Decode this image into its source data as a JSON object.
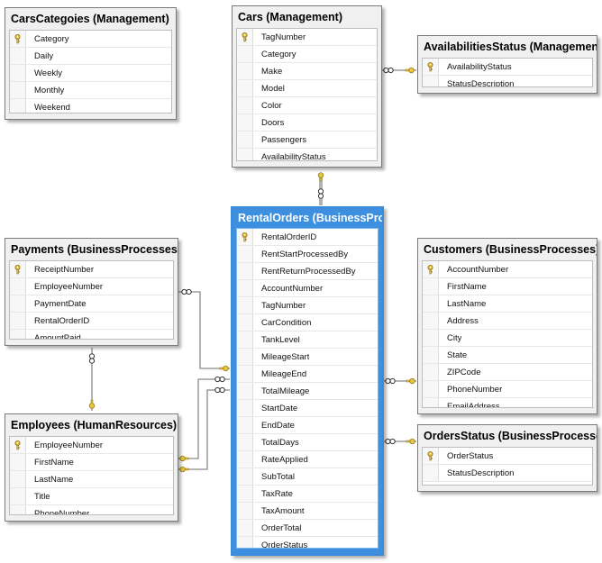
{
  "tables": [
    {
      "id": "carscategoies",
      "title": "CarsCategoies (Management)",
      "selected": false,
      "columns": [
        {
          "name": "Category",
          "pk": true
        },
        {
          "name": "Daily",
          "pk": false
        },
        {
          "name": "Weekly",
          "pk": false
        },
        {
          "name": "Monthly",
          "pk": false
        },
        {
          "name": "Weekend",
          "pk": false
        }
      ]
    },
    {
      "id": "cars",
      "title": "Cars (Management)",
      "selected": false,
      "columns": [
        {
          "name": "TagNumber",
          "pk": true
        },
        {
          "name": "Category",
          "pk": false
        },
        {
          "name": "Make",
          "pk": false
        },
        {
          "name": "Model",
          "pk": false
        },
        {
          "name": "Color",
          "pk": false
        },
        {
          "name": "Doors",
          "pk": false
        },
        {
          "name": "Passengers",
          "pk": false
        },
        {
          "name": "AvailabilityStatus",
          "pk": false
        }
      ]
    },
    {
      "id": "availabilitiesstatus",
      "title": "AvailabilitiesStatus (Management)",
      "selected": false,
      "columns": [
        {
          "name": "AvailabilityStatus",
          "pk": true
        },
        {
          "name": "StatusDescription",
          "pk": false
        }
      ]
    },
    {
      "id": "payments",
      "title": "Payments (BusinessProcesses)",
      "selected": false,
      "columns": [
        {
          "name": "ReceiptNumber",
          "pk": true
        },
        {
          "name": "EmployeeNumber",
          "pk": false
        },
        {
          "name": "PaymentDate",
          "pk": false
        },
        {
          "name": "RentalOrderID",
          "pk": false
        },
        {
          "name": "AmountPaid",
          "pk": false
        }
      ]
    },
    {
      "id": "rentalorders",
      "title": "RentalOrders (BusinessProc",
      "selected": true,
      "columns": [
        {
          "name": "RentalOrderID",
          "pk": true
        },
        {
          "name": "RentStartProcessedBy",
          "pk": false
        },
        {
          "name": "RentReturnProcessedBy",
          "pk": false
        },
        {
          "name": "AccountNumber",
          "pk": false
        },
        {
          "name": "TagNumber",
          "pk": false
        },
        {
          "name": "CarCondition",
          "pk": false
        },
        {
          "name": "TankLevel",
          "pk": false
        },
        {
          "name": "MileageStart",
          "pk": false
        },
        {
          "name": "MileageEnd",
          "pk": false
        },
        {
          "name": "TotalMileage",
          "pk": false
        },
        {
          "name": "StartDate",
          "pk": false
        },
        {
          "name": "EndDate",
          "pk": false
        },
        {
          "name": "TotalDays",
          "pk": false
        },
        {
          "name": "RateApplied",
          "pk": false
        },
        {
          "name": "SubTotal",
          "pk": false
        },
        {
          "name": "TaxRate",
          "pk": false
        },
        {
          "name": "TaxAmount",
          "pk": false
        },
        {
          "name": "OrderTotal",
          "pk": false
        },
        {
          "name": "OrderStatus",
          "pk": false
        }
      ]
    },
    {
      "id": "customers",
      "title": "Customers (BusinessProcesses)",
      "selected": false,
      "columns": [
        {
          "name": "AccountNumber",
          "pk": true
        },
        {
          "name": "FirstName",
          "pk": false
        },
        {
          "name": "LastName",
          "pk": false
        },
        {
          "name": "Address",
          "pk": false
        },
        {
          "name": "City",
          "pk": false
        },
        {
          "name": "State",
          "pk": false
        },
        {
          "name": "ZIPCode",
          "pk": false
        },
        {
          "name": "PhoneNumber",
          "pk": false
        },
        {
          "name": "EmailAddress",
          "pk": false
        }
      ]
    },
    {
      "id": "employees",
      "title": "Employees (HumanResources)",
      "selected": false,
      "columns": [
        {
          "name": "EmployeeNumber",
          "pk": true
        },
        {
          "name": "FirstName",
          "pk": false
        },
        {
          "name": "LastName",
          "pk": false
        },
        {
          "name": "Title",
          "pk": false
        },
        {
          "name": "PhoneNumber",
          "pk": false
        }
      ]
    },
    {
      "id": "ordersstatus",
      "title": "OrdersStatus (BusinessProcesses)",
      "selected": false,
      "columns": [
        {
          "name": "OrderStatus",
          "pk": true
        },
        {
          "name": "StatusDescription",
          "pk": false
        }
      ]
    }
  ],
  "relationships": [
    {
      "from": "cars",
      "to": "carscategoies"
    },
    {
      "from": "cars",
      "to": "availabilitiesstatus"
    },
    {
      "from": "rentalorders",
      "to": "cars"
    },
    {
      "from": "payments",
      "to": "rentalorders"
    },
    {
      "from": "payments",
      "to": "employees"
    },
    {
      "from": "rentalorders",
      "to": "employees"
    },
    {
      "from": "rentalorders",
      "to": "customers"
    },
    {
      "from": "rentalorders",
      "to": "ordersstatus"
    }
  ],
  "colors": {
    "selected_table": "#3d8fe0",
    "table_frame": "#f0f0f0",
    "key_icon": "#e8c640",
    "connector": "#8a8a8a"
  },
  "icons": {
    "primary_key": "key-icon",
    "one_end": "key-icon",
    "many_end": "infinity-icon"
  }
}
